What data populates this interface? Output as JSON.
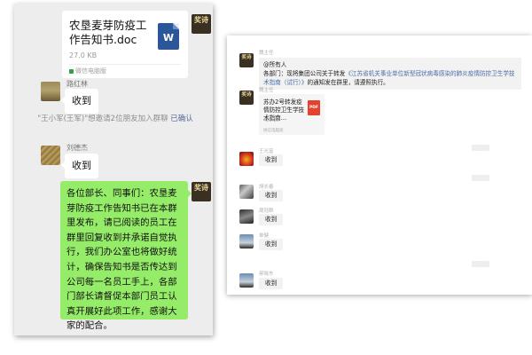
{
  "left_chat": {
    "file_card": {
      "title": "农垦麦芽防疫工作告知书.doc",
      "size": "27.0 KB",
      "source": "微信电脑版",
      "icon": "word-doc-icon",
      "icon_letter": "W"
    },
    "avatar_brand_text": "奖诗",
    "messages": [
      {
        "sender": "路红林",
        "text": "收到"
      },
      {
        "sender": "刘德杰",
        "text": "收到"
      }
    ],
    "system_notice": {
      "text": "\"王小军(王军)\"想邀请2位朋友加入群聊",
      "link": "已确认"
    },
    "announcement": "各位部长、同事们：农垦麦芽防疫工作告知书已在本群里发布，请已阅读的员工在群里回复收到并承诺自觉执行，我们办公室也将做好统计，确保告知书是否传达到公司每一名员工手上，各部门部长请督促本部门员工认真开展好此项工作，感谢大家的配合。"
  },
  "right_chat": {
    "avatar_brand_text": "奖诗",
    "sender_1": "魏主任",
    "message_1": {
      "mention": "@所有人",
      "text_before": "各部门：现将集团公司关于转发",
      "link": "《江苏省机关事业单位新型冠状病毒感染的肺炎疫情防控卫生学技术指南（试行）》",
      "text_after": "的通知发在群里，请遵照执行。"
    },
    "sender_2": "魏主任",
    "file_card": {
      "title": "苏办2号转发疫情防控卫生学技术指南...",
      "size": "460.1K",
      "source": "微信电脑版",
      "icon": "pdf-icon",
      "icon_label": "PDF"
    },
    "replies": [
      {
        "sender": "王光富",
        "text": "收到",
        "avatar": "red-abstract-avatar"
      },
      {
        "sender": "胡长春",
        "text": "收到",
        "avatar": "monochrome-avatar"
      },
      {
        "sender": "周冠群",
        "text": "收到",
        "avatar": "dark-photo-avatar"
      },
      {
        "sender": "单健",
        "text": "收到",
        "avatar": "sky-photo-avatar"
      },
      {
        "sender": "郝晓东",
        "text": "收到",
        "avatar": "sky-photo-avatar"
      }
    ]
  }
}
